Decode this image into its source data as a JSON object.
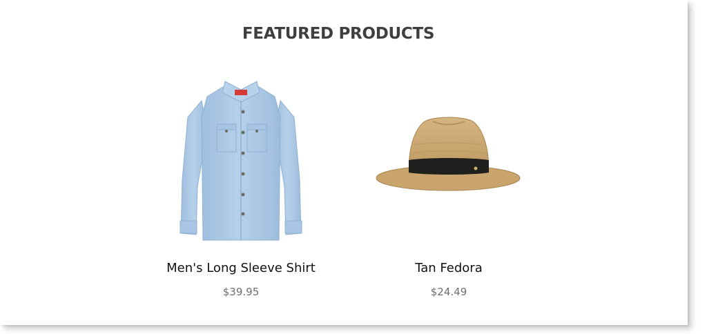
{
  "section": {
    "title": "FEATURED PRODUCTS"
  },
  "products": [
    {
      "name": "Men's Long Sleeve Shirt",
      "price": "$39.95",
      "image_icon": "shirt-icon",
      "color": "#a9c8e6"
    },
    {
      "name": "Tan Fedora",
      "price": "$24.49",
      "image_icon": "fedora-icon",
      "color": "#caa570"
    }
  ]
}
